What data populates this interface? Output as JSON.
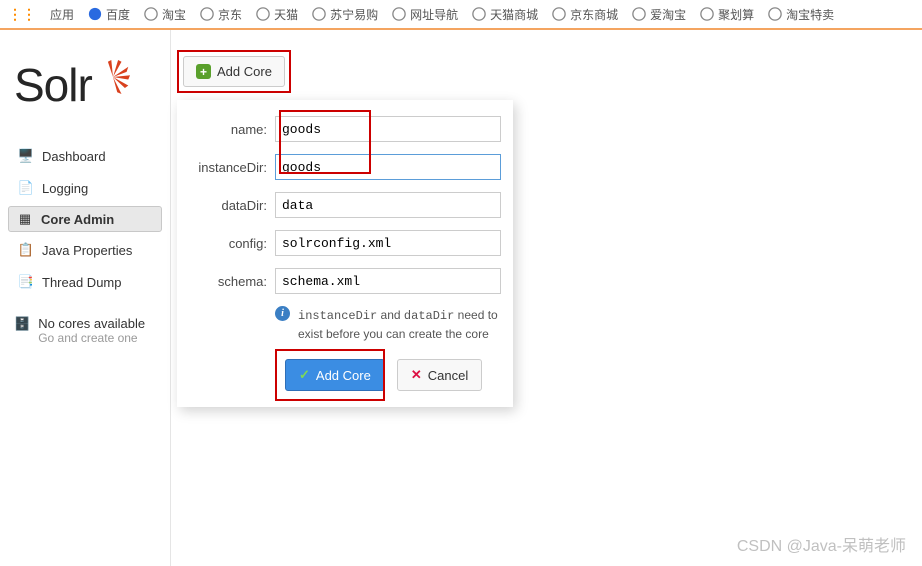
{
  "bookmarks": {
    "apps": "应用",
    "items": [
      "百度",
      "淘宝",
      "京东",
      "天猫",
      "苏宁易购",
      "网址导航",
      "天猫商城",
      "京东商城",
      "爱淘宝",
      "聚划算",
      "淘宝特卖"
    ]
  },
  "logo": "Solr",
  "nav": {
    "dashboard": "Dashboard",
    "logging": "Logging",
    "core_admin": "Core Admin",
    "java_properties": "Java Properties",
    "thread_dump": "Thread Dump"
  },
  "no_cores": {
    "title": "No cores available",
    "sub": "Go and create one"
  },
  "add_core_button": "Add Core",
  "dialog": {
    "labels": {
      "name": "name:",
      "instanceDir": "instanceDir:",
      "dataDir": "dataDir:",
      "config": "config:",
      "schema": "schema:"
    },
    "values": {
      "name": "goods",
      "instanceDir": "goods",
      "dataDir": "data",
      "config": "solrconfig.xml",
      "schema": "schema.xml"
    },
    "info_a": "instanceDir",
    "info_b": " and ",
    "info_c": "dataDir",
    "info_d": " need to exist before you can create the core",
    "submit": "Add Core",
    "cancel": "Cancel"
  },
  "watermark": "CSDN @Java-呆萌老师"
}
